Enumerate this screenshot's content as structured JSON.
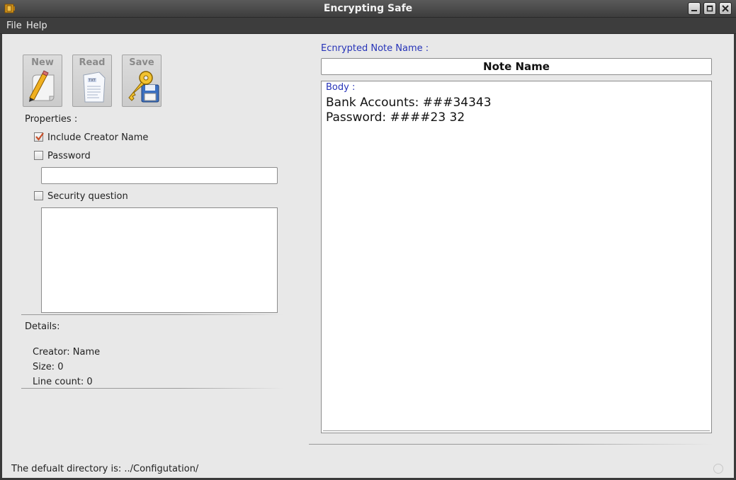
{
  "window": {
    "title": "Encrypting Safe"
  },
  "menu": {
    "file": "File",
    "help": "Help"
  },
  "toolbar": {
    "new_label": "New",
    "read_label": "Read",
    "save_label": "Save"
  },
  "properties": {
    "heading": "Properties :",
    "include_creator": {
      "label": "Include Creator Name",
      "checked": true
    },
    "password": {
      "label": "Password",
      "checked": false,
      "value": ""
    },
    "security_question": {
      "label": "Security question",
      "checked": false,
      "value": ""
    }
  },
  "details": {
    "heading": "Details:",
    "creator": "Creator: Name",
    "size": "Size:  0",
    "line_count": "Line count:  0"
  },
  "note": {
    "name_label": "Ecnrypted Note Name :",
    "name_value": "Note Name",
    "body_label": "Body :",
    "body_text": "Bank Accounts: ###34343\nPassword: ####23 32"
  },
  "status": {
    "text": "The defualt directory is: ../Configutation/"
  },
  "colors": {
    "accent_label": "#2633b8",
    "checkmark": "#c8502a"
  }
}
